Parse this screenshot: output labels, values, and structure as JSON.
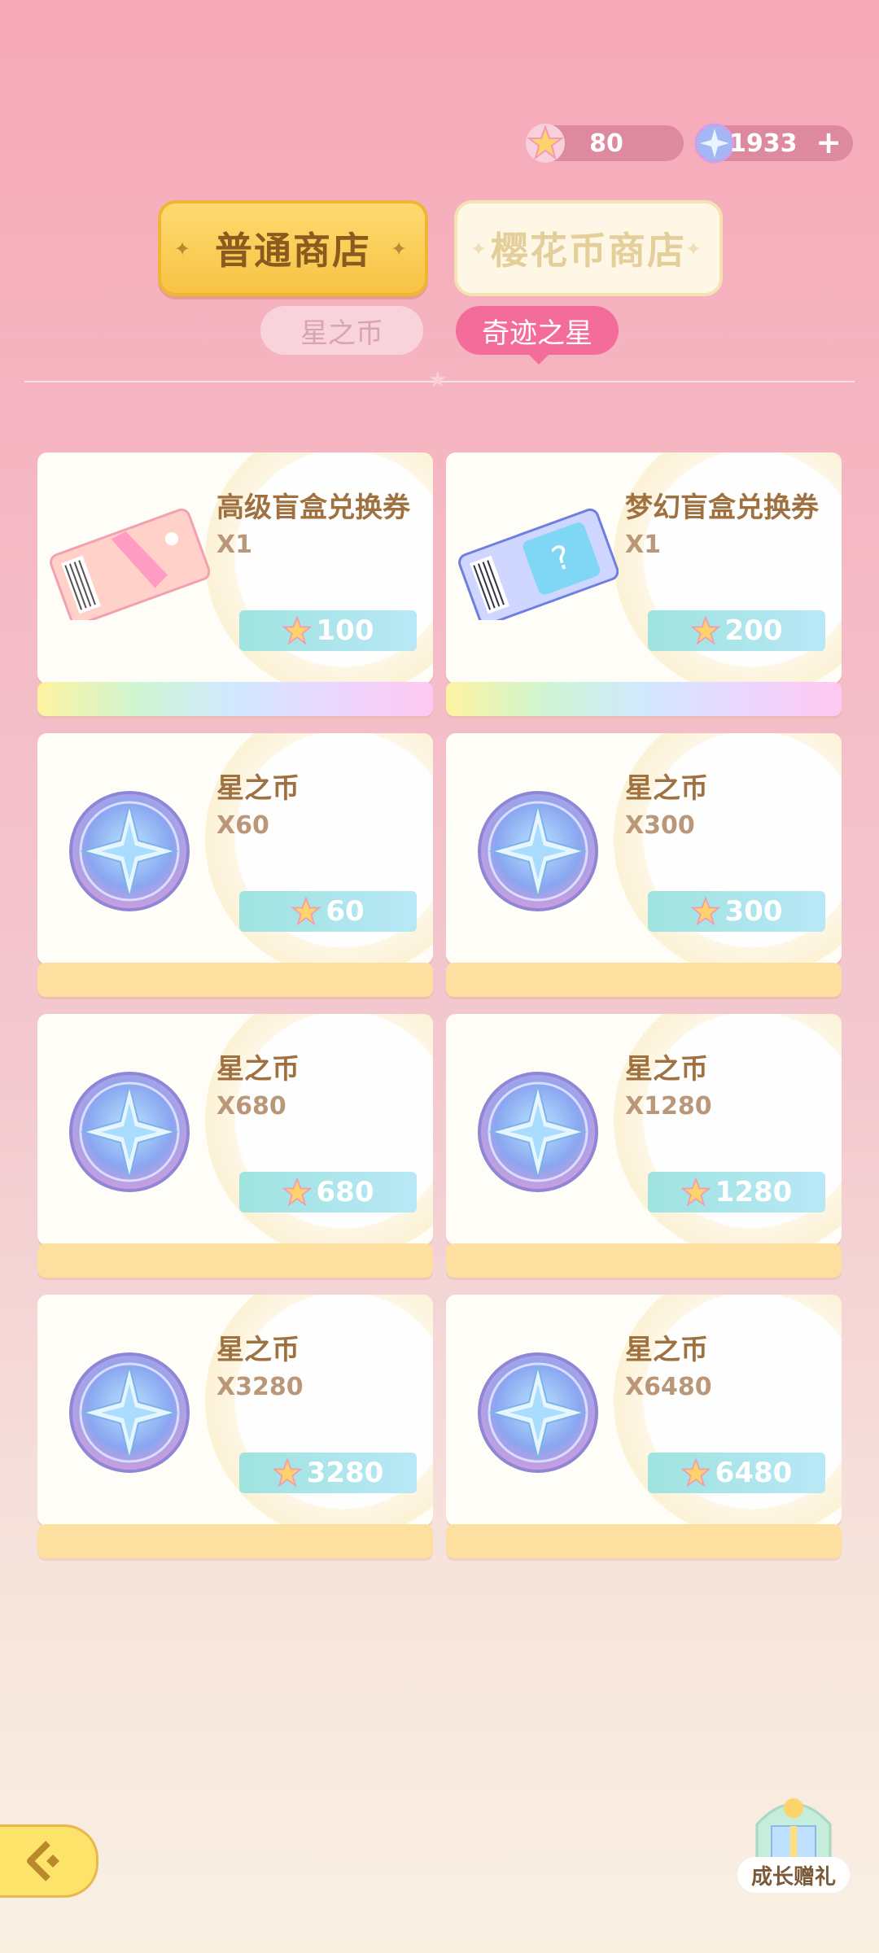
{
  "currency": {
    "star_points": "80",
    "crystals": "1933",
    "add_icon": "plus-icon"
  },
  "shop_tabs": [
    {
      "label": "普通商店",
      "active": true
    },
    {
      "label": "樱花币商店",
      "active": false
    }
  ],
  "sub_tabs": [
    {
      "label": "星之币",
      "active": false
    },
    {
      "label": "奇迹之星",
      "active": true
    }
  ],
  "items": [
    {
      "name": "高级盲盒兑换券",
      "qty": "X1",
      "price": "100",
      "image": "ticket-pink-icon",
      "footer": "rainbow"
    },
    {
      "name": "梦幻盲盒兑换券",
      "qty": "X1",
      "price": "200",
      "image": "ticket-blue-icon",
      "footer": "rainbow"
    },
    {
      "name": "星之币",
      "qty": "X60",
      "price": "60",
      "image": "star-coin-icon",
      "footer": "gold"
    },
    {
      "name": "星之币",
      "qty": "X300",
      "price": "300",
      "image": "star-coin-icon",
      "footer": "gold"
    },
    {
      "name": "星之币",
      "qty": "X680",
      "price": "680",
      "image": "star-coin-icon",
      "footer": "gold"
    },
    {
      "name": "星之币",
      "qty": "X1280",
      "price": "1280",
      "image": "star-coin-icon",
      "footer": "gold"
    },
    {
      "name": "星之币",
      "qty": "X3280",
      "price": "3280",
      "image": "star-coin-icon",
      "footer": "gold"
    },
    {
      "name": "星之币",
      "qty": "X6480",
      "price": "6480",
      "image": "star-coin-icon",
      "footer": "gold"
    }
  ],
  "gift": {
    "label": "成长赠礼"
  },
  "colors": {
    "accent_pink": "#f46c9a",
    "gold": "#f7c444",
    "price_bg": "#9fe3df"
  }
}
